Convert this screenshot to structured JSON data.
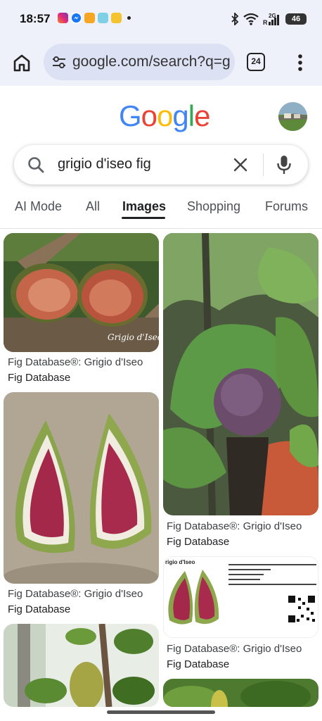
{
  "status_bar": {
    "time": "18:57",
    "battery": "46",
    "network": "2G"
  },
  "browser": {
    "url": "google.com/search?q=g",
    "tab_count": "24"
  },
  "google": {
    "logo_letters": [
      "G",
      "o",
      "o",
      "g",
      "l",
      "e"
    ],
    "logo_colors": [
      "#4285F4",
      "#EA4335",
      "#FBBC05",
      "#4285F4",
      "#34A853",
      "#EA4335"
    ],
    "query": "grigio d'iseo fig"
  },
  "tabs": [
    "AI Mode",
    "All",
    "Images",
    "Shopping",
    "Forums"
  ],
  "active_tab": "Images",
  "results": [
    {
      "title": "Fig Database®: Grigio d'Iseo",
      "source": "Fig Database",
      "watermark": "Grigio d'Iseo"
    },
    {
      "title": "Fig Database®: Grigio d'Iseo",
      "source": "Fig Database"
    },
    {
      "title": "Fig Database®: Grigio d'Iseo",
      "source": "Fig Database"
    },
    {
      "title": "Fig Database®: Grigio d'Iseo",
      "source": "Fig Database",
      "image_heading": "rigio d'Iseo"
    }
  ],
  "icons": [
    "home-icon",
    "tune-icon",
    "tabs-icon",
    "more-vert-icon",
    "search-icon",
    "close-icon",
    "mic-icon"
  ]
}
